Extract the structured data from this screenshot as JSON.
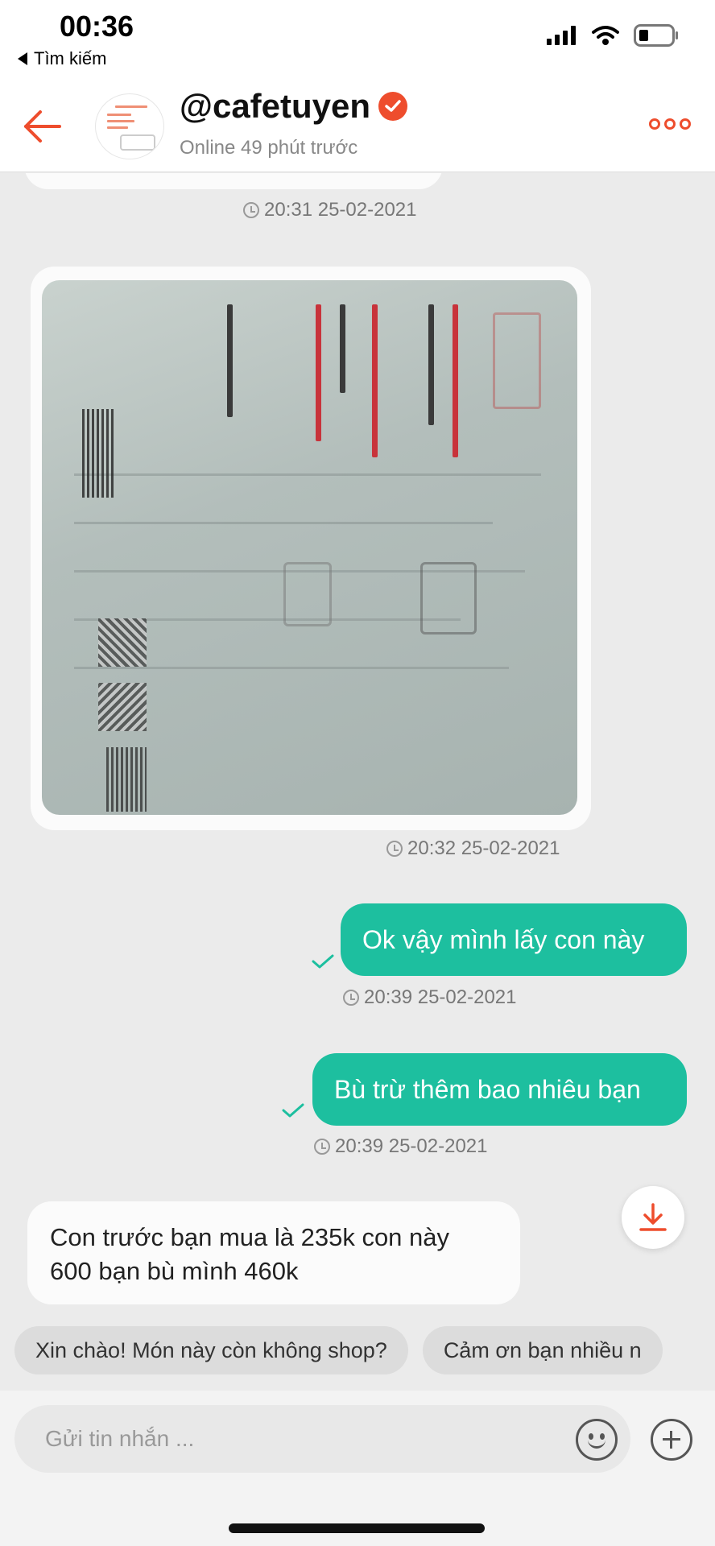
{
  "status": {
    "time": "00:36",
    "back_label": "Tìm kiếm"
  },
  "header": {
    "username": "@cafetuyen",
    "online_text": "Online 49 phút trước"
  },
  "messages": [
    {
      "side": "left",
      "type": "text-partial",
      "timestamp": "20:31 25-02-2021"
    },
    {
      "side": "left",
      "type": "image",
      "timestamp": "20:32 25-02-2021"
    },
    {
      "side": "right",
      "type": "text",
      "text": "Ok vậy mình lấy con này",
      "timestamp": "20:39 25-02-2021"
    },
    {
      "side": "right",
      "type": "text",
      "text": "Bù trừ thêm bao nhiêu bạn",
      "timestamp": "20:39 25-02-2021"
    },
    {
      "side": "left",
      "type": "text",
      "text_lines": [
        "Con trước bạn mua là 235k con này",
        "600 bạn bù mình 460k"
      ]
    }
  ],
  "quick_replies": [
    "Xin chào! Món này còn không shop?",
    "Cảm ơn bạn nhiều n"
  ],
  "composer": {
    "placeholder": "Gửi tin nhắn ..."
  },
  "colors": {
    "accent": "#ee4d2d",
    "sent_bubble": "#1dbf9f",
    "chat_bg": "#ebebeb"
  },
  "icons": {
    "back": "arrow-left-icon",
    "verified": "verified-check-icon",
    "more": "more-dots-icon",
    "download": "download-icon",
    "emoji": "smiley-icon",
    "attach": "plus-circle-icon"
  }
}
